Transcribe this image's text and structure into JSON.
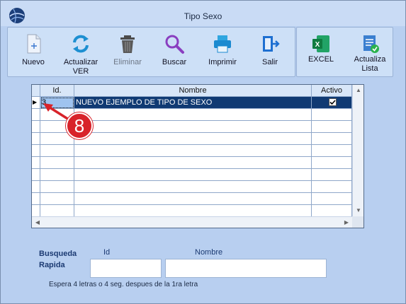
{
  "window": {
    "title": "Tipo Sexo"
  },
  "toolbar": {
    "nuevo": "Nuevo",
    "actualizar_line1": "Actualizar",
    "actualizar_line2": "VER",
    "eliminar": "Eliminar",
    "buscar": "Buscar",
    "imprimir": "Imprimir",
    "salir": "Salir",
    "excel": "EXCEL",
    "actualiza_line1": "Actualiza",
    "actualiza_line2": "Lista"
  },
  "grid": {
    "columns": [
      "Id.",
      "Nombre",
      "Activo"
    ],
    "rows": [
      {
        "id": "3",
        "nombre": "NUEVO EJEMPLO DE TIPO DE SEXO",
        "activo": true
      }
    ]
  },
  "annotation": {
    "number": "8",
    "color": "#d8232a"
  },
  "quick_search": {
    "label_line1": "Busqueda",
    "label_line2": "Rapida",
    "id_label": "Id",
    "nombre_label": "Nombre",
    "id_value": "",
    "nombre_value": "",
    "hint": "Espera 4 letras o 4 seg. despues de la 1ra letra"
  },
  "colors": {
    "selection": "#103a73",
    "background": "#b8cff0"
  }
}
